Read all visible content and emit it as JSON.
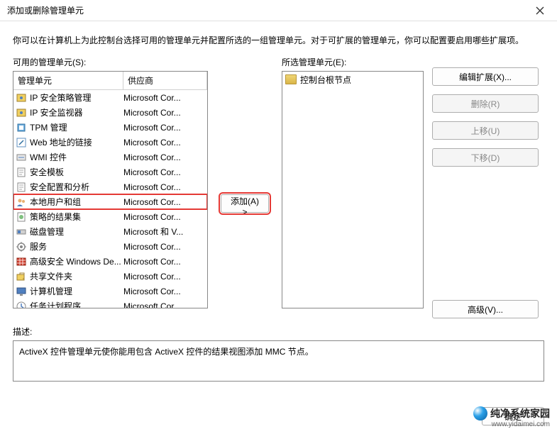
{
  "window": {
    "title": "添加或删除管理单元",
    "description": "你可以在计算机上为此控制台选择可用的管理单元并配置所选的一组管理单元。对于可扩展的管理单元，你可以配置要启用哪些扩展项。"
  },
  "labels": {
    "available": "可用的管理单元(S):",
    "selected": "所选管理单元(E):",
    "col_unit": "管理单元",
    "col_vendor": "供应商",
    "desc": "描述:"
  },
  "selected_root": "控制台根节点",
  "buttons": {
    "add": "添加(A) >",
    "edit_ext": "编辑扩展(X)...",
    "remove": "删除(R)",
    "move_up": "上移(U)",
    "move_down": "下移(D)",
    "advanced": "高级(V)...",
    "ok": "确定"
  },
  "desc_text": "ActiveX 控件管理单元使你能用包含 ActiveX 控件的结果视图添加 MMC 节点。",
  "snapins": [
    {
      "name": "IP 安全策略管理",
      "vendor": "Microsoft Cor...",
      "icon": "security",
      "hl": false
    },
    {
      "name": "IP 安全监视器",
      "vendor": "Microsoft Cor...",
      "icon": "security",
      "hl": false
    },
    {
      "name": "TPM 管理",
      "vendor": "Microsoft Cor...",
      "icon": "tpm",
      "hl": false
    },
    {
      "name": "Web 地址的链接",
      "vendor": "Microsoft Cor...",
      "icon": "link",
      "hl": false
    },
    {
      "name": "WMI 控件",
      "vendor": "Microsoft Cor...",
      "icon": "wmi",
      "hl": false
    },
    {
      "name": "安全模板",
      "vendor": "Microsoft Cor...",
      "icon": "template",
      "hl": false
    },
    {
      "name": "安全配置和分析",
      "vendor": "Microsoft Cor...",
      "icon": "template",
      "hl": false
    },
    {
      "name": "本地用户和组",
      "vendor": "Microsoft Cor...",
      "icon": "users",
      "hl": true
    },
    {
      "name": "策略的结果集",
      "vendor": "Microsoft Cor...",
      "icon": "policy",
      "hl": false
    },
    {
      "name": "磁盘管理",
      "vendor": "Microsoft 和 V...",
      "icon": "disk",
      "hl": false
    },
    {
      "name": "服务",
      "vendor": "Microsoft Cor...",
      "icon": "services",
      "hl": false
    },
    {
      "name": "高级安全 Windows De...",
      "vendor": "Microsoft Cor...",
      "icon": "firewall",
      "hl": false
    },
    {
      "name": "共享文件夹",
      "vendor": "Microsoft Cor...",
      "icon": "share",
      "hl": false
    },
    {
      "name": "计算机管理",
      "vendor": "Microsoft Cor...",
      "icon": "computer",
      "hl": false
    },
    {
      "name": "任务计划程序",
      "vendor": "Microsoft Cor...",
      "icon": "task",
      "hl": false
    }
  ],
  "watermark": {
    "name": "纯净系统家园",
    "url": "www.yidaimei.com"
  }
}
